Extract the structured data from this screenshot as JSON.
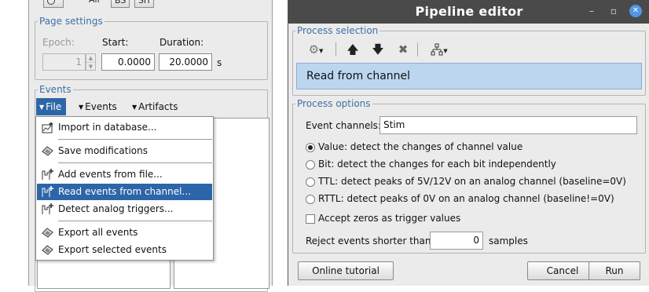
{
  "left_panel": {
    "top_strip": {
      "all_label": "All",
      "bst_label": "BS",
      "srf_label": "Srf"
    },
    "page_settings": {
      "legend": "Page settings",
      "epoch_label": "Epoch:",
      "epoch_value": "1",
      "start_label": "Start:",
      "start_value": "0.0000",
      "duration_label": "Duration:",
      "duration_value": "20.0000",
      "duration_unit": "s"
    },
    "events": {
      "legend": "Events",
      "menus": [
        {
          "label": "File"
        },
        {
          "label": "Events"
        },
        {
          "label": "Artifacts"
        }
      ],
      "file_menu": {
        "items": [
          {
            "label": "Import in database...",
            "icon": "import-database-icon"
          },
          {
            "label": "Save modifications",
            "icon": "save-icon"
          },
          {
            "label": "Add events from file...",
            "icon": "add-events-icon"
          },
          {
            "label": "Read events from channel...",
            "icon": "read-channel-icon"
          },
          {
            "label": "Detect analog triggers...",
            "icon": "detect-triggers-icon"
          },
          {
            "label": "Export all events",
            "icon": "export-icon"
          },
          {
            "label": "Export selected events",
            "icon": "export-selected-icon"
          }
        ],
        "selected_index": 3
      }
    }
  },
  "pipeline_editor": {
    "title": "Pipeline editor",
    "process_selection": {
      "legend": "Process selection",
      "toolbar_icons": [
        "gear-icon",
        "arrow-up-icon",
        "arrow-down-icon",
        "delete-icon",
        "pipeline-tree-icon"
      ],
      "items": [
        "Read from channel"
      ]
    },
    "process_options": {
      "legend": "Process options",
      "event_channels_label": "Event channels:",
      "event_channels_value": "Stim",
      "radio_options": [
        "Value: detect the changes of channel value",
        "Bit: detect the changes for each bit independently",
        "TTL: detect peaks of 5V/12V on an analog channel (baseline=0V)",
        "RTTL: detect peaks of 0V on an analog channel (baseline!=0V)"
      ],
      "radio_selected": 0,
      "accept_zeros_label": "Accept zeros as trigger values",
      "accept_zeros_checked": false,
      "reject_label": "Reject events shorter than:",
      "reject_value": "0",
      "reject_unit": "samples"
    },
    "buttons": {
      "tutorial": "Online tutorial",
      "cancel": "Cancel",
      "run": "Run"
    },
    "colors": {
      "selection": "#bcd6ef",
      "accent": "#2d66a8",
      "titlebar": "#4a4a4a",
      "legend": "#3d6fa8"
    }
  }
}
